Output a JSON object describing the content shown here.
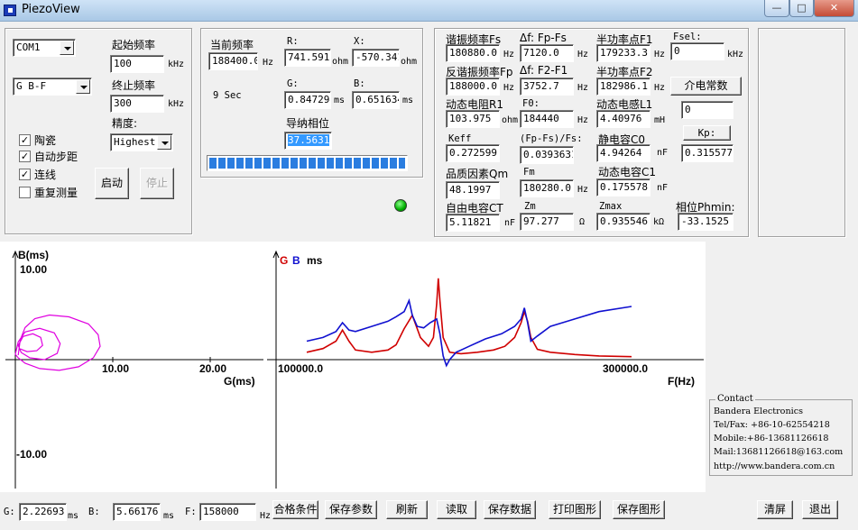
{
  "window": {
    "title": "PiezoView",
    "min": "—",
    "max": "□",
    "close": "✕"
  },
  "left_panel": {
    "com_port": "COM1",
    "mode": "G B-F",
    "start_freq_label": "起始频率",
    "start_freq": "100",
    "start_unit": "kHz",
    "end_freq_label": "终止频率",
    "end_freq": "300",
    "end_unit": "kHz",
    "precision_label": "精度:",
    "precision": "Highest",
    "checks": [
      {
        "label": "陶瓷",
        "checked": true
      },
      {
        "label": "自动步距",
        "checked": true
      },
      {
        "label": "连线",
        "checked": true
      },
      {
        "label": "重复测量",
        "checked": false
      }
    ],
    "start_button": "启动",
    "stop_button": "停止"
  },
  "middle_panel": {
    "cur_freq_label": "当前频率",
    "cur_freq": "188400.0",
    "cur_freq_unit": "Hz",
    "elapsed": "9 Sec",
    "r_label": "R:",
    "r_value": "741.591",
    "r_unit": "ohm",
    "x_label": "X:",
    "x_value": "-570.341",
    "x_unit": "ohm",
    "g_label": "G:",
    "g_value": "0.847294",
    "g_unit": "ms",
    "b_label": "B:",
    "b_value": "0.651634",
    "b_unit": "ms",
    "phase_label": "导纳相位",
    "phase_value": "37.5631",
    "progress": 1.0
  },
  "right_panel": {
    "fs_label": "谐振频率Fs",
    "fs_value": "180880.0",
    "fs_unit": "Hz",
    "dfs_label": "Δf: Fp-Fs",
    "dfs_value": "7120.0",
    "dfs_unit": "Hz",
    "f1_label": "半功率点F1",
    "f1_value": "179233.3",
    "f1_unit": "Hz",
    "fsel_label": "Fsel:",
    "fsel_value": "0",
    "fsel_unit": "kHz",
    "fp_label": "反谐振频率Fp",
    "fp_value": "188000.0",
    "fp_unit": "Hz",
    "df2_label": "Δf: F2-F1",
    "df2_value": "3752.7",
    "df2_unit": "Hz",
    "f2_label": "半功率点F2",
    "f2_value": "182986.1",
    "f2_unit": "Hz",
    "dielectric_button": "介电常数",
    "r1_label": "动态电阻R1",
    "r1_value": "103.975",
    "r1_unit": "ohm",
    "f0_label": "F0:",
    "f0_value": "184440",
    "f0_unit": "Hz",
    "l1_label": "动态电感L1",
    "l1_value": "4.40976",
    "l1_unit": "mH",
    "dielectric_value": "0",
    "keff_label": "Keff",
    "keff_value": "0.272599",
    "ratio_label": "(Fp-Fs)/Fs:",
    "ratio_value": "0.0393631",
    "c0_label": "静电容C0",
    "c0_value": "4.94264",
    "c0_unit": "nF",
    "kp_button": "Kp:",
    "kp_value": "0.315577",
    "qm_label": "品质因素Qm",
    "qm_value": "48.1997",
    "fm_label": "Fm",
    "fm_value": "180280.0",
    "fm_unit": "Hz",
    "c1_label": "动态电容C1",
    "c1_value": "0.175578",
    "c1_unit": "nF",
    "ct_label": "自由电容CT",
    "ct_value": "5.11821",
    "ct_unit": "nF",
    "zm_label": "Zm",
    "zm_value": "97.277",
    "zm_unit": "Ω",
    "zmax_label": "Zmax",
    "zmax_value": "0.935546",
    "zmax_unit": "kΩ",
    "phmin_label": "相位Phmin:",
    "phmin_value": "-33.1525"
  },
  "chart_data": [
    {
      "type": "line",
      "title": "",
      "xlabel": "G(ms)",
      "ylabel": "B(ms)",
      "xlim": [
        -0.5,
        27
      ],
      "ylim": [
        -10,
        10
      ],
      "x_ticks": [
        "10.00",
        "20.00"
      ],
      "y_ticks": [
        "10.00",
        "-10.00"
      ],
      "series": [
        {
          "color": "#e000e0",
          "x": [
            0.3,
            0.5,
            1.0,
            2.0,
            3.5,
            5.5,
            7.5,
            8.5,
            8.7,
            8.0,
            6.5,
            4.5,
            2.5,
            1.0,
            0.3,
            0.0,
            0.3,
            1.0,
            2.5,
            4.0,
            4.6,
            4.3,
            3.0,
            1.5,
            0.6,
            0.3,
            0.8,
            1.8,
            2.6,
            2.8,
            2.2,
            1.2,
            0.5
          ],
          "y": [
            0.5,
            2.2,
            3.6,
            4.6,
            5.0,
            4.8,
            4.0,
            2.8,
            1.5,
            0.2,
            -0.8,
            -1.2,
            -1.0,
            -0.4,
            0.2,
            0.6,
            2.0,
            3.1,
            3.5,
            3.0,
            1.8,
            0.7,
            0.0,
            0.2,
            0.8,
            1.6,
            2.6,
            2.9,
            2.5,
            1.6,
            1.0,
            0.9,
            1.2
          ]
        }
      ]
    },
    {
      "type": "line",
      "title": "",
      "xlabel": "F(Hz)",
      "ylabel": "",
      "xlim": [
        100000,
        300000
      ],
      "x_ticks": [
        "100000.0",
        "300000.0"
      ],
      "legend": [
        "G",
        "B"
      ],
      "series": [
        {
          "name": "G",
          "color": "#d00000",
          "x": [
            100000,
            110000,
            118000,
            122000,
            126000,
            130000,
            140000,
            150000,
            155000,
            160000,
            165000,
            170000,
            175000,
            178000,
            180000,
            181000,
            182000,
            184000,
            188000,
            195000,
            205000,
            215000,
            222000,
            228000,
            232000,
            234000,
            236000,
            238000,
            242000,
            250000,
            265000,
            280000,
            300000
          ],
          "y": [
            1.0,
            1.5,
            2.5,
            4.0,
            2.5,
            1.3,
            1.0,
            1.3,
            2.0,
            4.2,
            6.0,
            3.0,
            1.8,
            3.0,
            7.5,
            11.0,
            8.0,
            3.0,
            1.0,
            0.8,
            1.0,
            1.3,
            1.8,
            3.0,
            5.0,
            6.5,
            5.2,
            3.0,
            1.4,
            1.0,
            0.7,
            0.5,
            0.4
          ]
        },
        {
          "name": "B",
          "color": "#1010d0",
          "x": [
            100000,
            110000,
            118000,
            122000,
            126000,
            130000,
            140000,
            150000,
            155000,
            160000,
            163000,
            165000,
            168000,
            172000,
            176000,
            180000,
            182000,
            184000,
            186000,
            188000,
            192000,
            200000,
            210000,
            220000,
            228000,
            232000,
            234000,
            236000,
            238000,
            242000,
            250000,
            265000,
            280000,
            300000
          ],
          "y": [
            2.5,
            3.0,
            3.8,
            5.0,
            4.0,
            3.8,
            4.5,
            5.2,
            5.8,
            6.5,
            8.0,
            6.0,
            4.5,
            4.3,
            5.0,
            5.5,
            3.5,
            0.5,
            -0.8,
            0.0,
            1.0,
            1.8,
            2.8,
            3.5,
            4.5,
            5.5,
            7.0,
            5.0,
            2.5,
            3.2,
            4.5,
            5.5,
            6.5,
            7.2
          ]
        }
      ]
    }
  ],
  "contact": {
    "legend": "Contact",
    "lines": [
      "Bandera Electronics",
      "Tel/Fax: +86-10-62554218",
      "Mobile:+86-13681126618",
      "Mail:13681126618@163.com",
      "http://www.bandera.com.cn"
    ]
  },
  "bottom": {
    "g_label": "G:",
    "g_value": "2.22693",
    "g_unit": "ms",
    "b_label": "B:",
    "b_value": "5.66176",
    "b_unit": "ms",
    "f_label": "F:",
    "f_value": "158000",
    "f_unit": "Hz",
    "buttons": [
      "合格条件",
      "保存参数",
      "刷新",
      "读取",
      "保存数据",
      "打印图形",
      "保存图形"
    ],
    "clear_button": "清屏",
    "exit_button": "退出"
  }
}
